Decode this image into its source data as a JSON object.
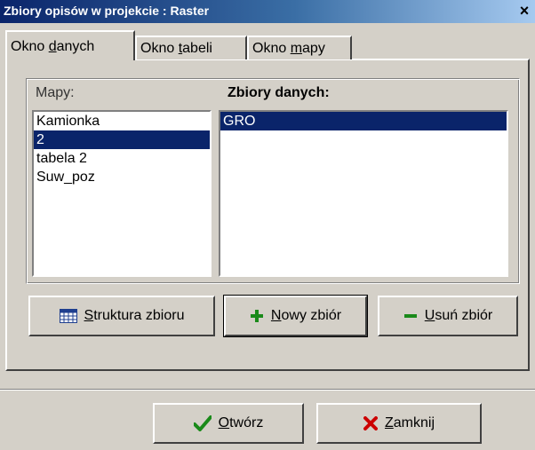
{
  "window": {
    "title": "Zbiory opisów w projekcie : Raster",
    "close_glyph": "×"
  },
  "tabs": [
    {
      "pre": "Okno ",
      "u": "d",
      "post": "anych",
      "active": true
    },
    {
      "pre": "Okno ",
      "u": "t",
      "post": "abeli",
      "active": false
    },
    {
      "pre": "Okno ",
      "u": "m",
      "post": "apy",
      "active": false
    }
  ],
  "maps": {
    "label": "Mapy:",
    "items": [
      "Kamionka",
      "2",
      "tabela 2",
      "Suw_poz"
    ],
    "selected_index": 1
  },
  "datasets": {
    "label": "Zbiory danych:",
    "items": [
      "GRO"
    ],
    "selected_index": 0
  },
  "buttons": {
    "struktura": {
      "u": "S",
      "rest": "truktura zbioru",
      "icon": "table-icon"
    },
    "nowy": {
      "u": "N",
      "rest": "owy zbiór",
      "icon": "plus-icon",
      "color": "#1a8a1a"
    },
    "usun": {
      "u": "U",
      "rest": "suń zbiór",
      "icon": "minus-icon",
      "color": "#1a8a1a"
    },
    "otworz": {
      "u": "O",
      "rest": "twórz",
      "icon": "checkmark-icon",
      "color": "#1a8a1a"
    },
    "zamknij": {
      "u": "Z",
      "rest": "amknij",
      "icon": "x-mark-icon",
      "color": "#cc0000"
    }
  }
}
